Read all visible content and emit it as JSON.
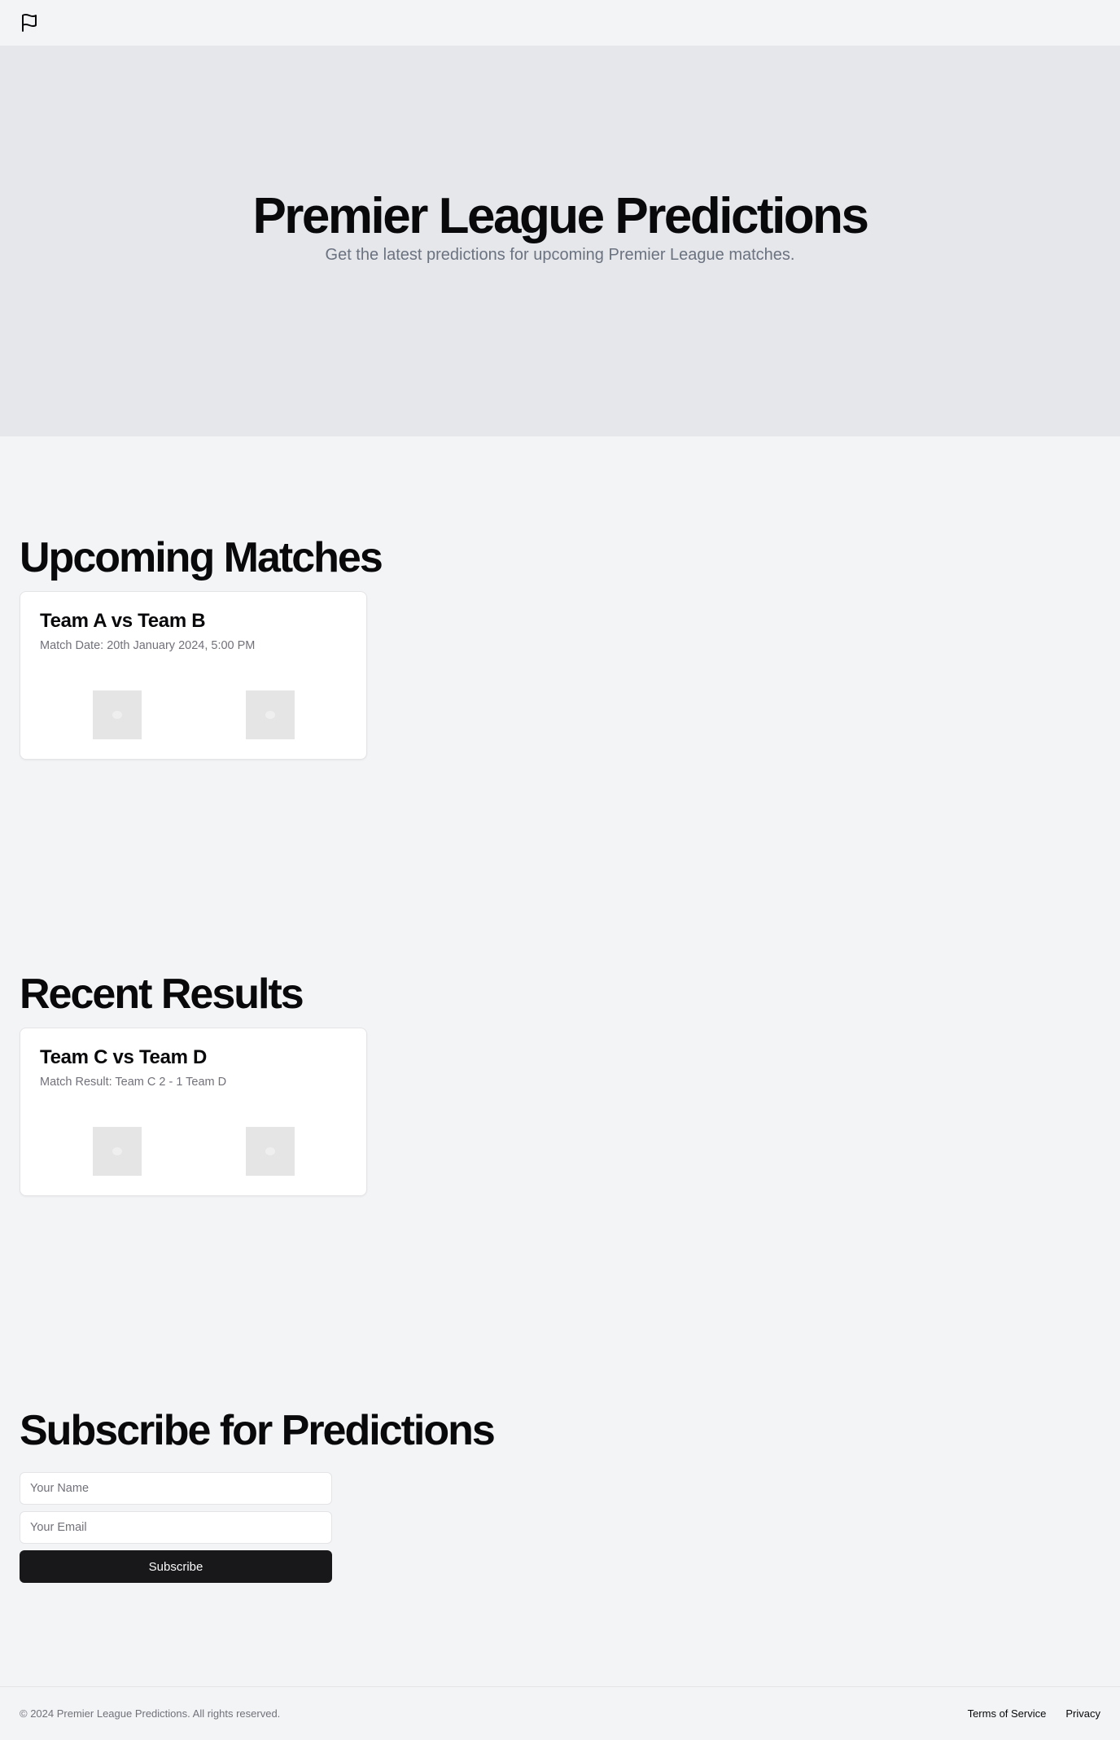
{
  "header": {
    "logo_icon": "flag-icon"
  },
  "hero": {
    "title": "Premier League Predictions",
    "subtitle": "Get the latest predictions for upcoming Premier League matches."
  },
  "upcoming": {
    "title": "Upcoming Matches",
    "cards": [
      {
        "title": "Team A vs Team B",
        "detail": "Match Date: 20th January 2024, 5:00 PM",
        "logos": [
          "image-placeholder-icon",
          "image-placeholder-icon"
        ]
      }
    ]
  },
  "results": {
    "title": "Recent Results",
    "cards": [
      {
        "title": "Team C vs Team D",
        "detail": "Match Result: Team C 2 - 1 Team D",
        "logos": [
          "image-placeholder-icon",
          "image-placeholder-icon"
        ]
      }
    ]
  },
  "subscribe": {
    "title": "Subscribe for Predictions",
    "name_placeholder": "Your Name",
    "email_placeholder": "Your Email",
    "button_label": "Subscribe"
  },
  "footer": {
    "copyright": "© 2024 Premier League Predictions. All rights reserved.",
    "links": [
      "Terms of Service",
      "Privacy"
    ]
  },
  "colors": {
    "background": "#f3f4f6",
    "hero_background": "#e5e7eb",
    "primary_button": "#18181b",
    "muted_text": "#71717a"
  }
}
